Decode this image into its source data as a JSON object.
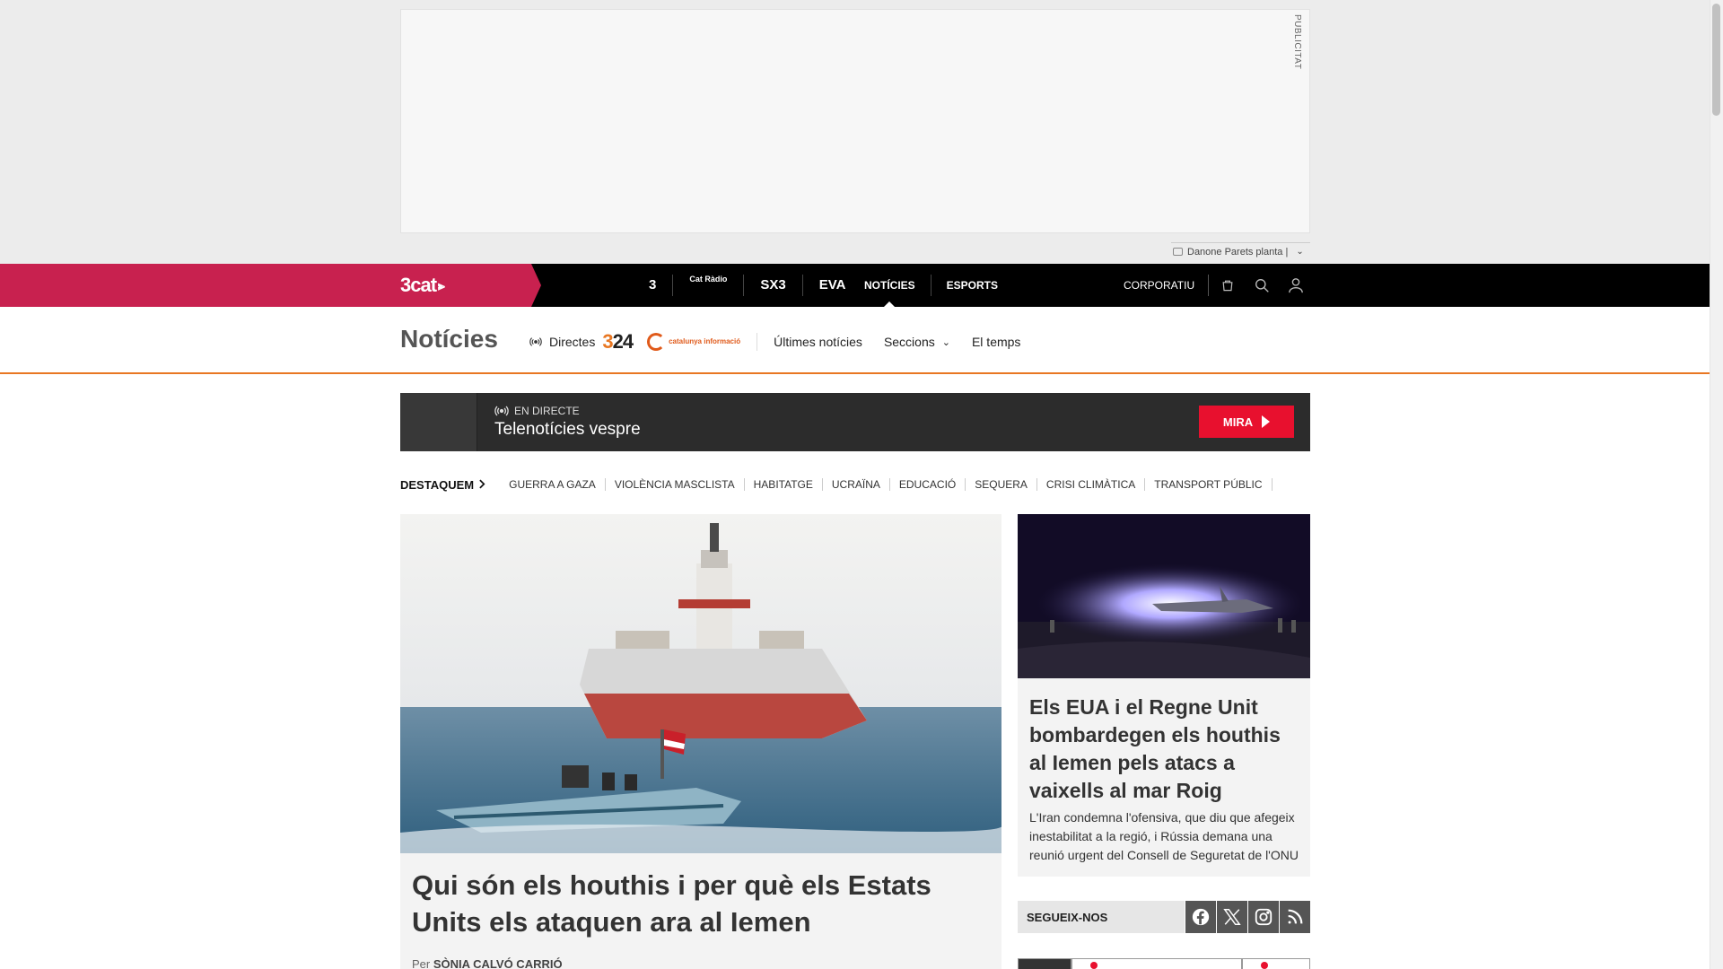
{
  "ad": {
    "label": "PUBLICITAT",
    "sponsor": "Danone Parets planta |"
  },
  "topnav": {
    "brand": "3cat",
    "channels": [
      {
        "label": "3",
        "name": "tv3"
      },
      {
        "label": "Cat Ràdio",
        "name": "catradio"
      },
      {
        "label": "SX3",
        "name": "sx3"
      },
      {
        "label": "EVA",
        "name": "eva"
      }
    ],
    "links": [
      {
        "label": "NOTÍCIES",
        "active": true
      },
      {
        "label": "ESPORTS",
        "active": false
      }
    ],
    "corporate": "CORPORATIU"
  },
  "section": {
    "title": "Notícies",
    "directes": "Directes",
    "logo_324": "324",
    "logo_ci": "catalunya informació",
    "links": [
      "Últimes notícies",
      "Seccions",
      "El temps"
    ]
  },
  "live": {
    "badge": "EN DIRECTE",
    "title": "Telenotícies vespre",
    "button": "MIRA"
  },
  "destaquem": {
    "label": "DESTAQUEM",
    "tags": [
      "GUERRA A GAZA",
      "VIOLÈNCIA MASCLISTA",
      "HABITATGE",
      "UCRAÏNA",
      "EDUCACIÓ",
      "SEQUERA",
      "CRISI CLIMÀTICA",
      "TRANSPORT PÚBLIC"
    ]
  },
  "main_article": {
    "title": "Qui són els houthis i per què els Estats Units els ataquen ara al Iemen",
    "byline_prefix": "Per",
    "author": "SÒNIA CALVÓ CARRIÓ"
  },
  "side_article": {
    "title": "Els EUA i el Regne Unit bombardegen els houthis al Iemen pels atacs a vaixells al mar Roig",
    "summary": "L'Iran condemna l'ofensiva, que diu que afegeix inestabilitat a la regió, i Rússia demana una reunió urgent del Consell de Seguretat de l'ONU"
  },
  "follow": {
    "label": "SEGUEIX-NOS",
    "networks": [
      "facebook-icon",
      "x-icon",
      "instagram-icon",
      "rss-icon"
    ]
  },
  "colors": {
    "brand": "#c8214f",
    "accent": "#e87722",
    "live_button": "#e8102e"
  }
}
